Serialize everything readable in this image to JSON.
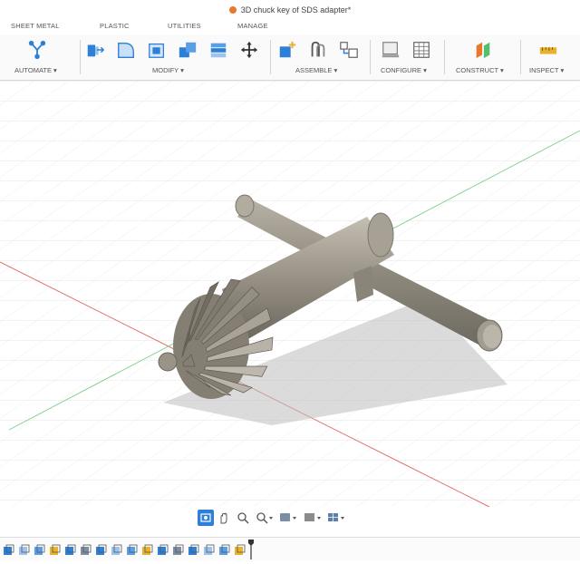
{
  "window": {
    "title": "3D chuck key of SDS adapter*"
  },
  "tabs": [
    "SHEET METAL",
    "PLASTIC",
    "UTILITIES",
    "MANAGE"
  ],
  "toolbar": {
    "automate": "AUTOMATE ▾",
    "modify": "MODIFY ▾",
    "assemble": "ASSEMBLE ▾",
    "configure": "CONFIGURE ▾",
    "construct": "CONSTRUCT ▾",
    "inspect": "INSPECT ▾"
  },
  "colors": {
    "accent": "#2d7fd8",
    "orange": "#e8782c",
    "x_axis": "#e26a6a",
    "y_axis": "#55c06a"
  },
  "navbar": {
    "tools": [
      "orbit-icon",
      "pan-icon",
      "zoom-icon",
      "zoom-window-icon",
      "display-settings-icon",
      "grid-settings-icon",
      "viewports-icon"
    ],
    "selected": "orbit-icon"
  },
  "timeline": {
    "feature_count": 16
  }
}
